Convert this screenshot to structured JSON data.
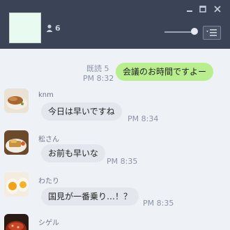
{
  "header": {
    "member_count": "6"
  },
  "messages": [
    {
      "sender": "",
      "text": "会議のお時間ですよー",
      "time": "PM 8:32",
      "read": "既読 5",
      "direction": "out",
      "avatar": ""
    },
    {
      "sender": "knm",
      "text": "今日は早いですね",
      "time": "PM 8:34",
      "direction": "in",
      "avatar": "food-photo-avatar"
    },
    {
      "sender": "松さん",
      "text": "お前も早いな",
      "time": "PM 8:35",
      "direction": "in",
      "avatar": "meal-photo-avatar"
    },
    {
      "sender": "わたり",
      "text": "国見が一番乗り…！？",
      "time": "PM 8:35",
      "direction": "in",
      "avatar": "eggs-photo-avatar"
    },
    {
      "sender": "シゲル",
      "text": "",
      "time": "",
      "direction": "in",
      "avatar": "rice-bowl-photo-avatar"
    }
  ],
  "colors": {
    "header_bg": "#3b4456",
    "chat_bg": "#eef1f6",
    "outgoing_bubble": "#b8ee8e",
    "incoming_bubble": "#e3e6ec"
  }
}
